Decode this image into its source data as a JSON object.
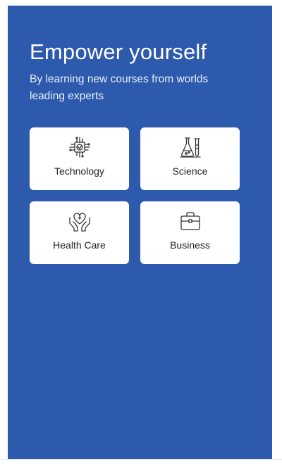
{
  "hero": {
    "title": "Empower yourself",
    "subtitle": "By learning new courses from worlds leading experts"
  },
  "categories": [
    {
      "label": "Technology",
      "icon": "chip-icon"
    },
    {
      "label": "Science",
      "icon": "lab-flask-icon"
    },
    {
      "label": "Health Care",
      "icon": "heart-hands-icon"
    },
    {
      "label": "Business",
      "icon": "briefcase-icon"
    }
  ],
  "colors": {
    "panel_background": "#2d5aad",
    "card_background": "#ffffff",
    "text_on_panel": "#ffffff",
    "card_text": "#222222"
  }
}
